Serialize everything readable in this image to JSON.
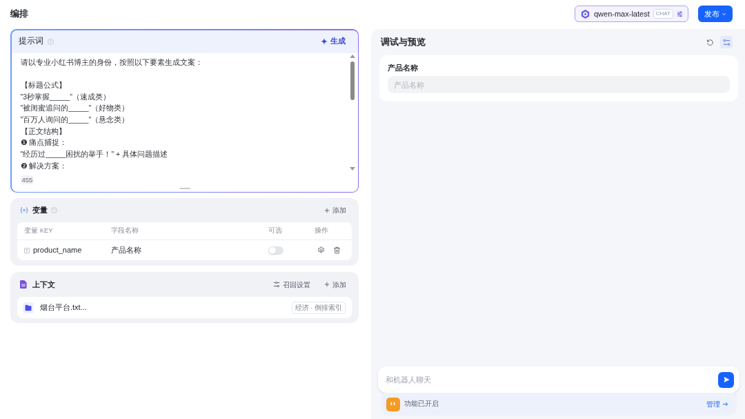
{
  "header": {
    "title": "编排",
    "model": {
      "name": "qwen-max-latest",
      "tag": "CHAT"
    },
    "publish_button": "发布"
  },
  "prompt": {
    "title": "提示词",
    "generate_button": "生成",
    "paragraphs": [
      {
        "lines": [
          "请以专业小红书博主的身份，按照以下要素生成文案："
        ]
      },
      {
        "lines": [
          "【标题公式】",
          "\"3秒掌握_____\"（速成类）",
          "\"被闺蜜追问的_____\"（好物类）",
          "\"百万人询问的_____\"（悬念类）",
          "【正文结构】",
          "❶ 痛点捕捉：",
          "\"经历过_____困扰的举手！\" + 具体问题描述",
          "❷ 解决方案："
        ]
      }
    ],
    "char_count": "455"
  },
  "variables": {
    "title": "变量",
    "add_button": "添加",
    "columns": [
      "变量 KEY",
      "字段名称",
      "可选",
      "操作"
    ],
    "rows": [
      {
        "key": "product_name",
        "field_name": "产品名称",
        "optional": false
      }
    ]
  },
  "context": {
    "title": "上下文",
    "recall_settings_button": "召回设置",
    "add_button": "添加",
    "files": [
      {
        "name": "烟台平台.txt...",
        "tag": "经济 · 倒排索引"
      }
    ]
  },
  "preview": {
    "title": "调试与预览",
    "toolbar": [
      {
        "kind": "refresh",
        "selected": false
      },
      {
        "kind": "settings",
        "selected": true
      }
    ],
    "fields": [
      {
        "label": "产品名称",
        "placeholder": "产品名称"
      }
    ],
    "chat_input": {
      "placeholder": "和机器人聊天"
    },
    "feature_bar": {
      "text": "功能已开启",
      "link": "管理"
    }
  }
}
